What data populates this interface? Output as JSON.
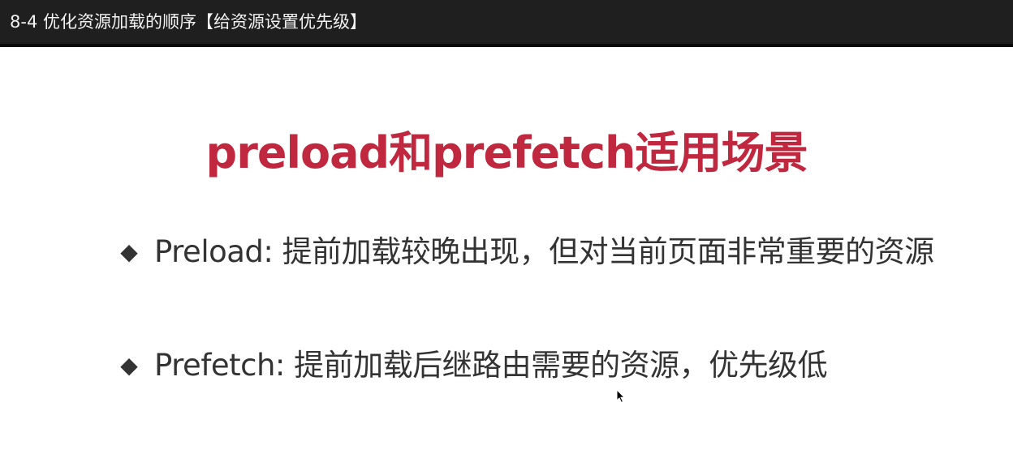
{
  "window": {
    "title": "8-4 优化资源加载的顺序【给资源设置优先级】"
  },
  "slide": {
    "title": "preload和prefetch适用场景",
    "title_color": "#c0283f",
    "bullet_icon": "diamond-bullet-icon",
    "bullet_glyph": "◆",
    "bullets": [
      {
        "text": "Preload: 提前加载较晚出现，但对当前页面非常重要的资源"
      },
      {
        "text": "Prefetch: 提前加载后继路由需要的资源，优先级低"
      }
    ]
  },
  "cursor": {
    "icon": "mouse-pointer-icon"
  }
}
